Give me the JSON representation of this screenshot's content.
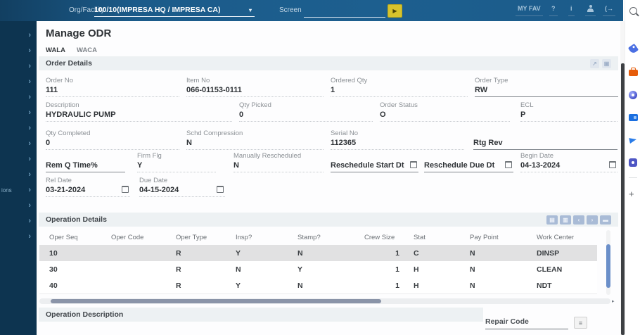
{
  "topbar": {
    "org_facility_label": "Org/Facility",
    "org_facility_value": "100/10(IMPRESA HQ / IMPRESA CA)",
    "screen_label": "Screen",
    "screen_value": "",
    "my_fav": "MY FAV",
    "help": "?",
    "info": "i"
  },
  "sidebar": {
    "items": [
      "",
      "",
      "",
      "",
      "",
      "",
      "",
      "",
      "",
      "",
      "ions",
      "",
      "",
      ""
    ]
  },
  "rail": {
    "icons": [
      "search",
      "tag",
      "toolbox",
      "orbit",
      "wallet",
      "send",
      "teams"
    ],
    "plus": "+"
  },
  "page": {
    "title": "Manage ODR",
    "tabs": [
      {
        "label": "WALA",
        "active": true
      },
      {
        "label": "WACA",
        "active": false
      }
    ]
  },
  "order_details": {
    "title": "Order Details",
    "rows": [
      [
        {
          "label": "Order No",
          "value": "111"
        },
        {
          "label": "Item No",
          "value": "066-01153-0111"
        },
        {
          "label": "Ordered Qty",
          "value": "1"
        },
        {
          "label": "Order Type",
          "value": "RW",
          "solid": true
        }
      ],
      [
        {
          "label": "Description",
          "value": "HYDRAULIC PUMP"
        },
        {
          "label": "Qty Picked",
          "value": "0"
        },
        {
          "label": "Order Status",
          "value": "O"
        },
        {
          "label": "ECL",
          "value": "P"
        }
      ],
      [
        {
          "label": "Qty Completed",
          "value": "0"
        },
        {
          "label": "Schd Compression",
          "value": "N"
        },
        {
          "label": "Serial No",
          "value": "112365"
        },
        {
          "label": "Rtg Rev",
          "value": "",
          "labelAsValue": true,
          "solid": true
        }
      ],
      [
        {
          "label": "Rem Q Time%",
          "value": "",
          "labelAsValue": true,
          "solid": true
        },
        {
          "label": "Firm Flg",
          "value": "Y"
        },
        {
          "label": "Manually Rescheduled",
          "value": "N"
        },
        {
          "label": "Reschedule Start Dt",
          "value": "",
          "labelAsValue": true,
          "solid": true,
          "calendar": true
        },
        {
          "label": "Reschedule Due Dt",
          "value": "",
          "labelAsValue": true,
          "solid": true,
          "calendar": true
        },
        {
          "label": "Begin Date",
          "value": "04-13-2024",
          "calendar": true
        }
      ],
      [
        {
          "label": "Rel Date",
          "value": "03-21-2024",
          "calendar": true
        },
        {
          "label": "Due Date",
          "value": "04-15-2024",
          "calendar": true
        }
      ]
    ]
  },
  "operation_details": {
    "title": "Operation Details",
    "columns": [
      "Oper Seq",
      "Oper Code",
      "Oper Type",
      "Insp?",
      "Stamp?",
      "Crew Size",
      "Stat",
      "Pay Point",
      "Work Center"
    ],
    "rows": [
      [
        "10",
        "",
        "R",
        "Y",
        "N",
        "1",
        "C",
        "N",
        "DINSP"
      ],
      [
        "30",
        "",
        "R",
        "N",
        "Y",
        "1",
        "H",
        "N",
        "CLEAN"
      ],
      [
        "40",
        "",
        "R",
        "Y",
        "N",
        "1",
        "H",
        "N",
        "NDT"
      ]
    ],
    "selected_row": 0
  },
  "operation_description": {
    "title": "Operation Description"
  },
  "repair_code": {
    "label": "Repair Code"
  },
  "icons": {
    "run": "▶",
    "dropdown": "▾",
    "logout": "(→",
    "expand": "↗",
    "grid": "▣",
    "add": "▤",
    "delete": "▥",
    "prev": "‹",
    "next": "›",
    "more": "▬",
    "menu": "≡",
    "chevron": "›"
  },
  "colors": {
    "topbar": "#1d5f8f",
    "sidebar": "#0d3450",
    "accent_yellow": "#d7c32c",
    "section_bg": "#edf1f3",
    "selected_row": "#e1e1e2"
  }
}
